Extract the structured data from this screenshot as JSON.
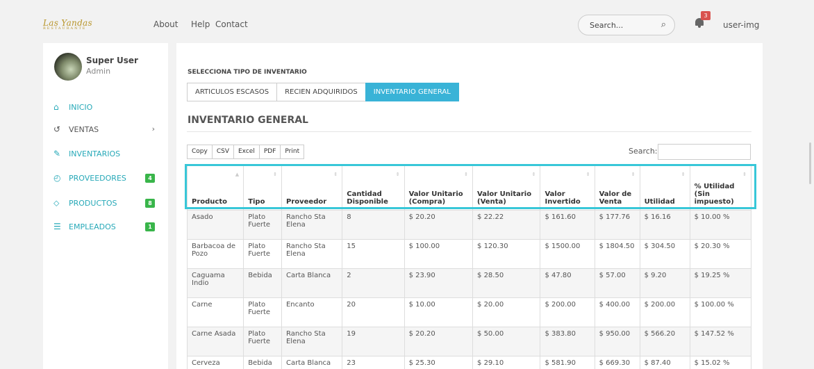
{
  "brand": {
    "logo": "Las Yandas",
    "sub": "RESTAURANTE"
  },
  "nav": {
    "about": "About",
    "help": "Help",
    "contact": "Contact"
  },
  "header": {
    "search_placeholder": "Search...",
    "notifications": "3",
    "user": "user-img"
  },
  "user": {
    "name": "Super User",
    "role": "Admin"
  },
  "sidebar": {
    "items": [
      {
        "label": "INICIO",
        "icon": "home-icon"
      },
      {
        "label": "VENTAS",
        "icon": "ventas-icon"
      },
      {
        "label": "INVENTARIOS",
        "icon": "edit-icon"
      },
      {
        "label": "PROVEEDORES",
        "icon": "clock-icon",
        "count": "4"
      },
      {
        "label": "PRODUCTOS",
        "icon": "tag-icon",
        "count": "8"
      },
      {
        "label": "EMPLEADOS",
        "icon": "list-icon",
        "count": "1"
      }
    ]
  },
  "main": {
    "select_label": "SELECCIONA TIPO DE INVENTARIO",
    "tabs": [
      "ARTICULOS ESCASOS",
      "RECIEN ADQUIRIDOS",
      "INVENTARIO GENERAL"
    ],
    "active_tab": "INVENTARIO GENERAL",
    "section_title": "INVENTARIO GENERAL",
    "export_buttons": [
      "Copy",
      "CSV",
      "Excel",
      "PDF",
      "Print"
    ],
    "search_label": "Search:"
  },
  "table": {
    "headers": [
      "Producto",
      "Tipo",
      "Proveedor",
      "Cantidad Disponible",
      "Valor Unitario (Compra)",
      "Valor Unitario (Venta)",
      "Valor Invertido",
      "Valor de Venta",
      "Utilidad",
      "% Utilidad (Sin impuesto)"
    ],
    "rows": [
      [
        "Asado",
        "Plato Fuerte",
        "Rancho Sta Elena",
        "8",
        "$ 20.20",
        "$ 22.22",
        "$ 161.60",
        "$ 177.76",
        "$ 16.16",
        "$ 10.00 %"
      ],
      [
        "Barbacoa de Pozo",
        "Plato Fuerte",
        "Rancho Sta Elena",
        "15",
        "$ 100.00",
        "$ 120.30",
        "$ 1500.00",
        "$ 1804.50",
        "$ 304.50",
        "$ 20.30 %"
      ],
      [
        "Caguama Indio",
        "Bebida",
        "Carta Blanca",
        "2",
        "$ 23.90",
        "$ 28.50",
        "$ 47.80",
        "$ 57.00",
        "$ 9.20",
        "$ 19.25 %"
      ],
      [
        "Carne",
        "Plato Fuerte",
        "Encanto",
        "20",
        "$ 10.00",
        "$ 20.00",
        "$ 200.00",
        "$ 400.00",
        "$ 200.00",
        "$ 100.00 %"
      ],
      [
        "Carne Asada",
        "Plato Fuerte",
        "Rancho Sta Elena",
        "19",
        "$ 20.20",
        "$ 50.00",
        "$ 383.80",
        "$ 950.00",
        "$ 566.20",
        "$ 147.52 %"
      ],
      [
        "Cerveza",
        "Bebida",
        "Carta Blanca",
        "23",
        "$ 25.30",
        "$ 29.10",
        "$ 581.90",
        "$ 669.30",
        "$ 87.40",
        "$ 15.02 %"
      ]
    ]
  },
  "colors": {
    "accent": "#27a9b8",
    "active_tab": "#39b3d7",
    "badge_green": "#39b54a",
    "badge_red": "#d9534f",
    "highlight": "#38c7d8"
  }
}
